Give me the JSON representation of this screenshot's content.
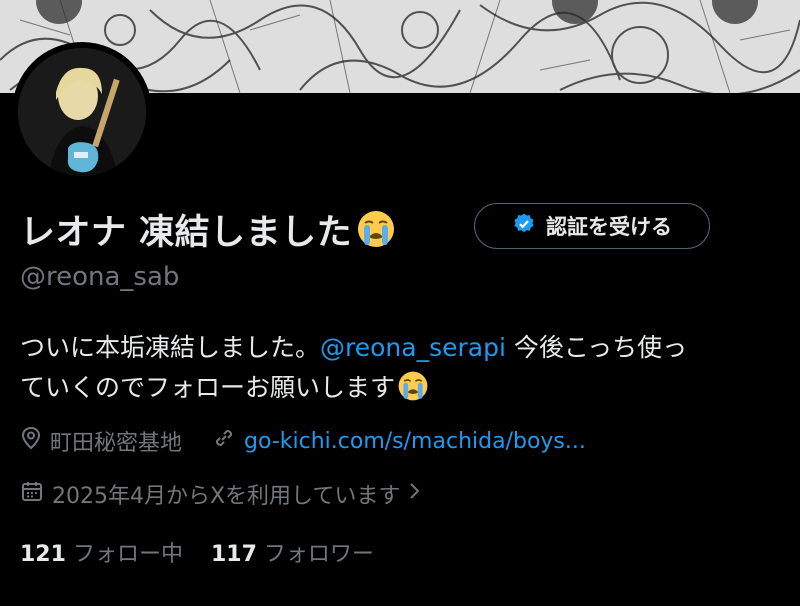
{
  "profile": {
    "display_name": "レオナ 凍結しました",
    "handle": "@reona_sab",
    "verify_button_label": "認証を受ける",
    "bio_text_1": "ついに本垢凍結しました。",
    "bio_mention": "@reona_serapi",
    "bio_text_2": " 今後こっち使っ",
    "bio_text_3": "ていくのでフォローお願いします",
    "location": "町田秘密基地",
    "website": "go-kichi.com/s/machida/boys...",
    "joined": "2025年4月からXを利用しています",
    "following_count": "121",
    "following_label": "フォロー中",
    "followers_count": "117",
    "followers_label": "フォロワー"
  },
  "icons": {
    "verify": "verified-badge-icon",
    "location": "location-pin-icon",
    "link": "link-icon",
    "calendar": "calendar-icon",
    "chevron": "chevron-right-icon",
    "emoji": "loudly-crying-face-emoji"
  },
  "colors": {
    "background": "#000000",
    "text": "#e7e9ea",
    "secondary": "#71767b",
    "accent": "#1d9bf0"
  }
}
